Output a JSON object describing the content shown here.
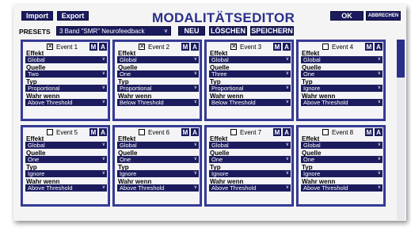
{
  "header": {
    "import_label": "Import",
    "export_label": "Export",
    "title": "MODALITÄTSEDITOR",
    "ok_label": "OK",
    "cancel_label": "ABBRECHEN"
  },
  "presets": {
    "label": "PRESETS",
    "selected": "3 Band \"SMR\" Neurofeedback",
    "new_label": "NEU",
    "delete_label": "LÖSCHEN",
    "save_label": "SPEICHERN"
  },
  "field_labels": {
    "effekt": "Effekt",
    "quelle": "Quelle",
    "typ": "Typ",
    "wahr_wenn": "Wahr wenn"
  },
  "panel_buttons": {
    "m": "M",
    "a": "A"
  },
  "events": [
    {
      "label": "Event 1",
      "checked": true,
      "effekt": "Global",
      "quelle": "Two",
      "typ": "Proportional",
      "wahr_wenn": "Above Threshold"
    },
    {
      "label": "Event 2",
      "checked": true,
      "effekt": "Global",
      "quelle": "One",
      "typ": "Proportional",
      "wahr_wenn": "Below Threshold"
    },
    {
      "label": "Event 3",
      "checked": true,
      "effekt": "Global",
      "quelle": "Three",
      "typ": "Proportional",
      "wahr_wenn": "Below Threshold"
    },
    {
      "label": "Event 4",
      "checked": false,
      "effekt": "Global",
      "quelle": "One",
      "typ": "Ignore",
      "wahr_wenn": "Above Threshold"
    },
    {
      "label": "Event 5",
      "checked": false,
      "effekt": "Global",
      "quelle": "One",
      "typ": "Ignore",
      "wahr_wenn": "Above Threshold"
    },
    {
      "label": "Event 6",
      "checked": false,
      "effekt": "Global",
      "quelle": "One",
      "typ": "Ignore",
      "wahr_wenn": "Above Threshold"
    },
    {
      "label": "Event 7",
      "checked": false,
      "effekt": "Global",
      "quelle": "One",
      "typ": "Ignore",
      "wahr_wenn": "Above Threshold"
    },
    {
      "label": "Event 8",
      "checked": false,
      "effekt": "Global",
      "quelle": "One",
      "typ": "Ignore",
      "wahr_wenn": "Above Threshold"
    }
  ],
  "icons": {
    "checkbox_mark": "✕",
    "dropdown": "chevron-down-icon"
  },
  "colors": {
    "accent": "#1b1b5e",
    "title": "#2a2f8a",
    "panel_border": "#2a2f8a"
  }
}
